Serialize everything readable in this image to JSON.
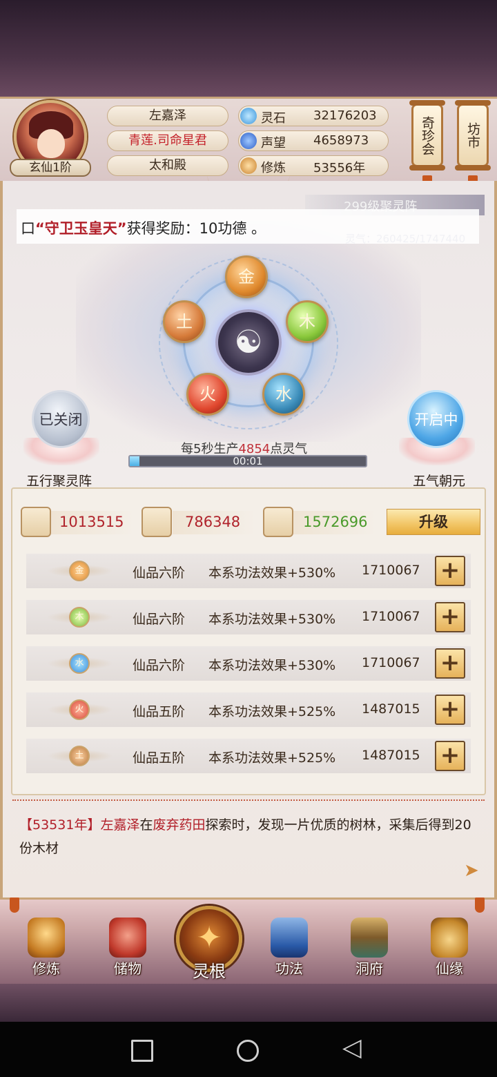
{
  "player": {
    "name": "左嘉泽",
    "title": "青莲.司命星君",
    "location": "太和殿",
    "rank": "玄仙1阶"
  },
  "resources": [
    {
      "label": "灵石",
      "value": "32176203",
      "icon": "spirit-stone-icon",
      "color": "#4fa8e8"
    },
    {
      "label": "声望",
      "value": "4658973",
      "icon": "reputation-icon",
      "color": "#3d7be0"
    },
    {
      "label": "修炼",
      "value": "53556年",
      "icon": "meditation-icon",
      "color": "#d6923e"
    }
  ],
  "side_buttons": {
    "treasure_fair": "奇珍会",
    "market": "坊市"
  },
  "news": {
    "prefix": "口",
    "highlight": "“守卫玉皇天”",
    "text": "获得奖励：10功德 。"
  },
  "array_info": {
    "level": "299级聚灵阵",
    "lingqi": "灵气：260425/1747440"
  },
  "elements": {
    "metal": "金",
    "wood": "木",
    "water": "水",
    "fire": "火",
    "earth": "土"
  },
  "left_array": {
    "status": "已关闭",
    "label": "五行聚灵阵"
  },
  "right_array": {
    "status": "开启中",
    "label": "五气朝元"
  },
  "production": {
    "prefix": "每5秒生产",
    "amount": "4854",
    "suffix": "点灵气",
    "timer": "00:01",
    "progress": 0.04
  },
  "materials": [
    {
      "value": "1013515",
      "icon": "scroll-material-icon",
      "color": "#b0232b"
    },
    {
      "value": "786348",
      "icon": "wood-material-icon",
      "color": "#b0232b"
    },
    {
      "value": "1572696",
      "icon": "herb-material-icon",
      "color": "#4a9a2a"
    }
  ],
  "upgrade_label": "升级",
  "element_rows": [
    {
      "element": "金",
      "grade": "仙品六阶",
      "effect": "本系功法效果+530%",
      "cost": "1710067",
      "color": "#e3a04a"
    },
    {
      "element": "木",
      "grade": "仙品六阶",
      "effect": "本系功法效果+530%",
      "cost": "1710067",
      "color": "#7bb83a"
    },
    {
      "element": "水",
      "grade": "仙品六阶",
      "effect": "本系功法效果+530%",
      "cost": "1710067",
      "color": "#3f8ed8"
    },
    {
      "element": "火",
      "grade": "仙品五阶",
      "effect": "本系功法效果+525%",
      "cost": "1487015",
      "color": "#d8493a"
    },
    {
      "element": "土",
      "grade": "仙品五阶",
      "effect": "本系功法效果+525%",
      "cost": "1487015",
      "color": "#b87a3e"
    }
  ],
  "log": {
    "year": "【53531年】",
    "name": "左嘉泽",
    "mid1": "在",
    "place": "废弃药田",
    "rest": "探索时，发现一片优质的树林，采集后得到20份木材"
  },
  "nav": [
    {
      "label": "修炼",
      "icon": "cultivate-icon"
    },
    {
      "label": "储物",
      "icon": "storage-bag-icon"
    },
    {
      "label": "灵根",
      "icon": "spirit-root-icon"
    },
    {
      "label": "功法",
      "icon": "technique-book-icon"
    },
    {
      "label": "洞府",
      "icon": "cave-dwelling-icon"
    },
    {
      "label": "仙缘",
      "icon": "fortune-gourd-icon"
    }
  ]
}
